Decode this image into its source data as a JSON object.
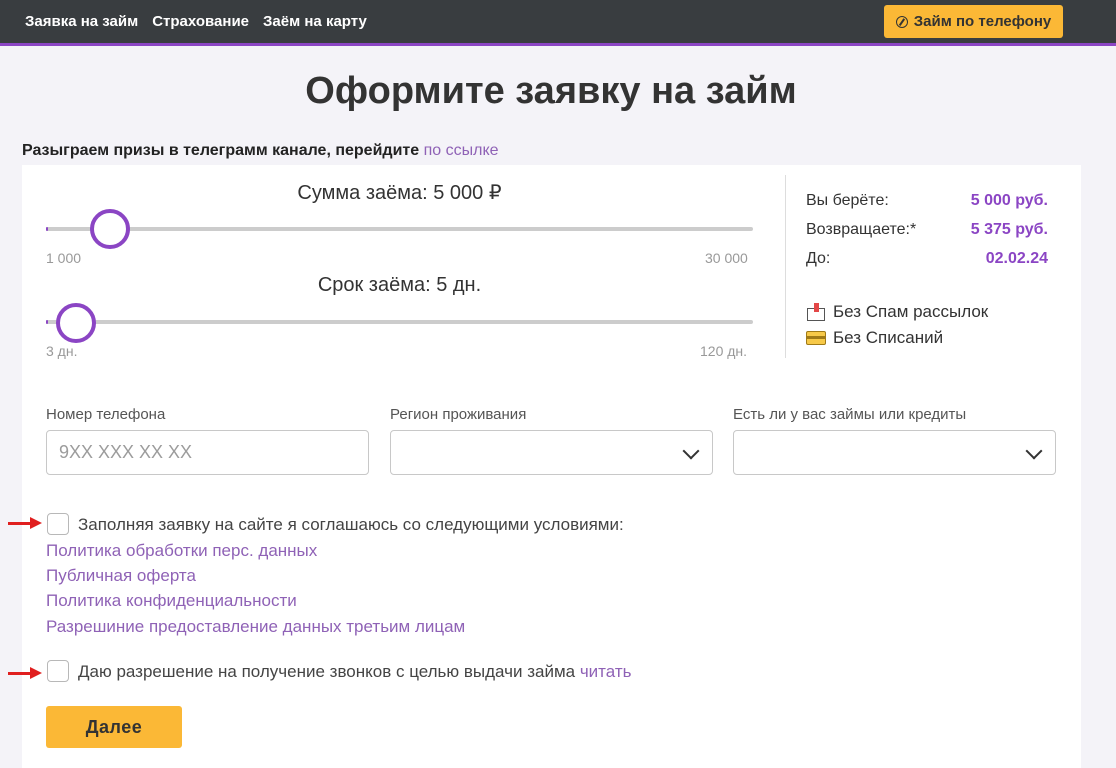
{
  "nav": {
    "items": [
      "Заявка на займ",
      "Страхование",
      "Заём на карту"
    ],
    "phone_button": "Займ по телефону"
  },
  "page_title": "Оформите заявку на займ",
  "promo": {
    "text": "Разыграем призы в  телеграмм канале, перейдите ",
    "link": "по ссылке"
  },
  "sliders": {
    "amount": {
      "title": "Сумма заёма: 5 000 ₽",
      "min": "1 000",
      "max": "30 000",
      "value": 5000,
      "range": [
        1000,
        30000
      ]
    },
    "term": {
      "title": "Срок заёма: 5 дн.",
      "min": "3 дн.",
      "max": "120 дн.",
      "value": 5,
      "range": [
        3,
        120
      ]
    }
  },
  "summary": {
    "take_label": "Вы берёте:",
    "take_value": "5 000 руб.",
    "return_label": "Возвращаете:*",
    "return_value": "5 375 руб.",
    "until_label": "До:",
    "until_value": "02.02.24",
    "feature_no_spam": "Без Спам рассылок",
    "feature_no_charges": "Без Списаний"
  },
  "form": {
    "phone_label": "Номер телефона",
    "phone_placeholder": "9XX XXX XX XX",
    "region_label": "Регион проживания",
    "region_value": "",
    "loans_label": "Есть ли у вас займы или кредиты",
    "loans_value": ""
  },
  "consent": {
    "agree_text": "Заполняя заявку на сайте я соглашаюсь со следующими условиями:",
    "links": [
      "Политика обработки перс. данных",
      "Публичная оферта",
      "Политика конфиденциальности",
      "Разрешиние предоставление данных третьим лицам"
    ],
    "calls_text": "Даю разрешение на получение звонков с целью выдачи займа ",
    "calls_link": "читать"
  },
  "next_button": "Далее",
  "colors": {
    "accent": "#8b45c4",
    "button": "#fbb836",
    "link": "#8f62b6",
    "arrow": "#e01f1f"
  }
}
